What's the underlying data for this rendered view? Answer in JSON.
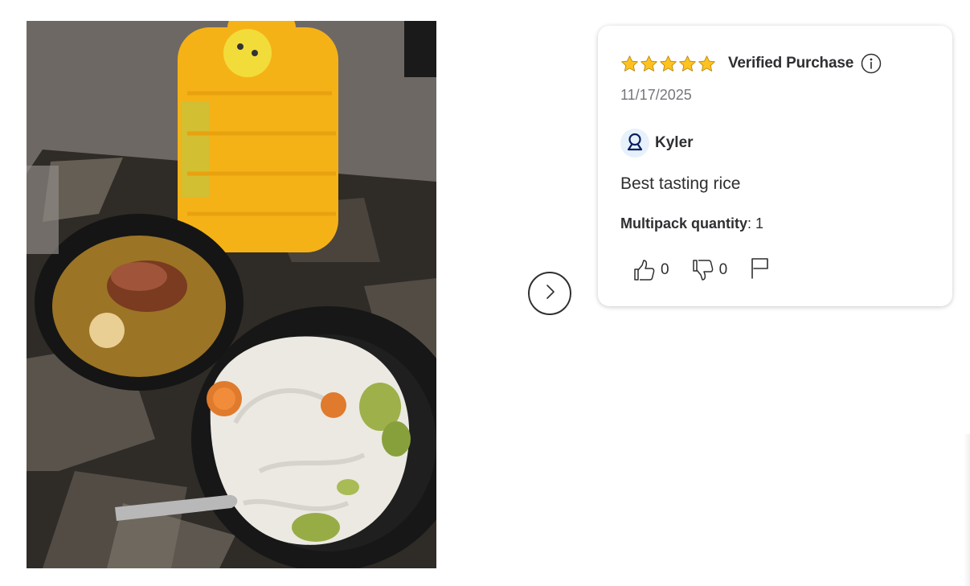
{
  "photo": {
    "alt": "Customer photo: bowl of rice with carrots and broccoli, bowl of soup, yellow bottle"
  },
  "navigation": {
    "next_icon": "chevron-right-icon"
  },
  "review": {
    "rating": 5,
    "rating_max": 5,
    "star_color": "#ffc220",
    "verified_label": "Verified Purchase",
    "info_icon": "info-icon",
    "date": "11/17/2025",
    "author": "Kyler",
    "avatar_icon": "user-icon",
    "avatar_color": "#0071dc",
    "text": "Best tasting rice",
    "attributes": [
      {
        "label": "Multipack quantity",
        "value": ": 1"
      }
    ],
    "helpful_count": "0",
    "unhelpful_count": "0",
    "report_icon": "flag-icon"
  }
}
